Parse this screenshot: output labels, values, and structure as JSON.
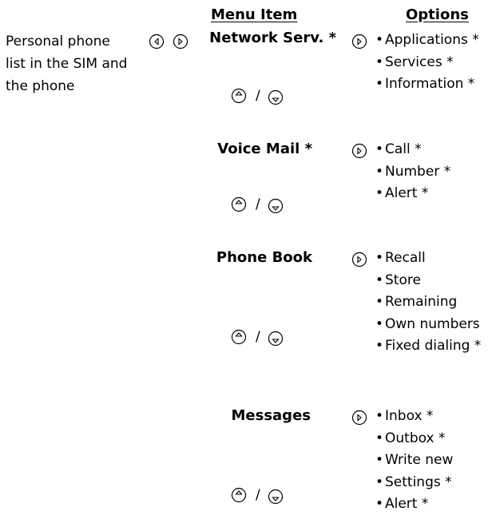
{
  "headers": {
    "menu_item": "Menu Item",
    "options": "Options"
  },
  "description": {
    "line1": "Personal phone",
    "line2": "list in the SIM and",
    "line3": "the phone"
  },
  "nav_separator": "/",
  "icons": {
    "left": "left-arrow-key-icon",
    "right": "right-arrow-key-icon",
    "up": "up-arrow-key-icon",
    "down": "down-arrow-key-icon"
  },
  "menus": [
    {
      "label": "Network Serv. *",
      "options": [
        "Applications *",
        "Services *",
        "Information *"
      ]
    },
    {
      "label": "Voice Mail *",
      "options": [
        "Call *",
        "Number *",
        "Alert *"
      ]
    },
    {
      "label": "Phone Book",
      "options": [
        "Recall",
        "Store",
        "Remaining",
        "Own numbers",
        "Fixed dialing *"
      ]
    },
    {
      "label": "Messages",
      "options": [
        "Inbox *",
        "Outbox *",
        "Write new",
        "Settings *",
        "Alert *"
      ]
    }
  ]
}
